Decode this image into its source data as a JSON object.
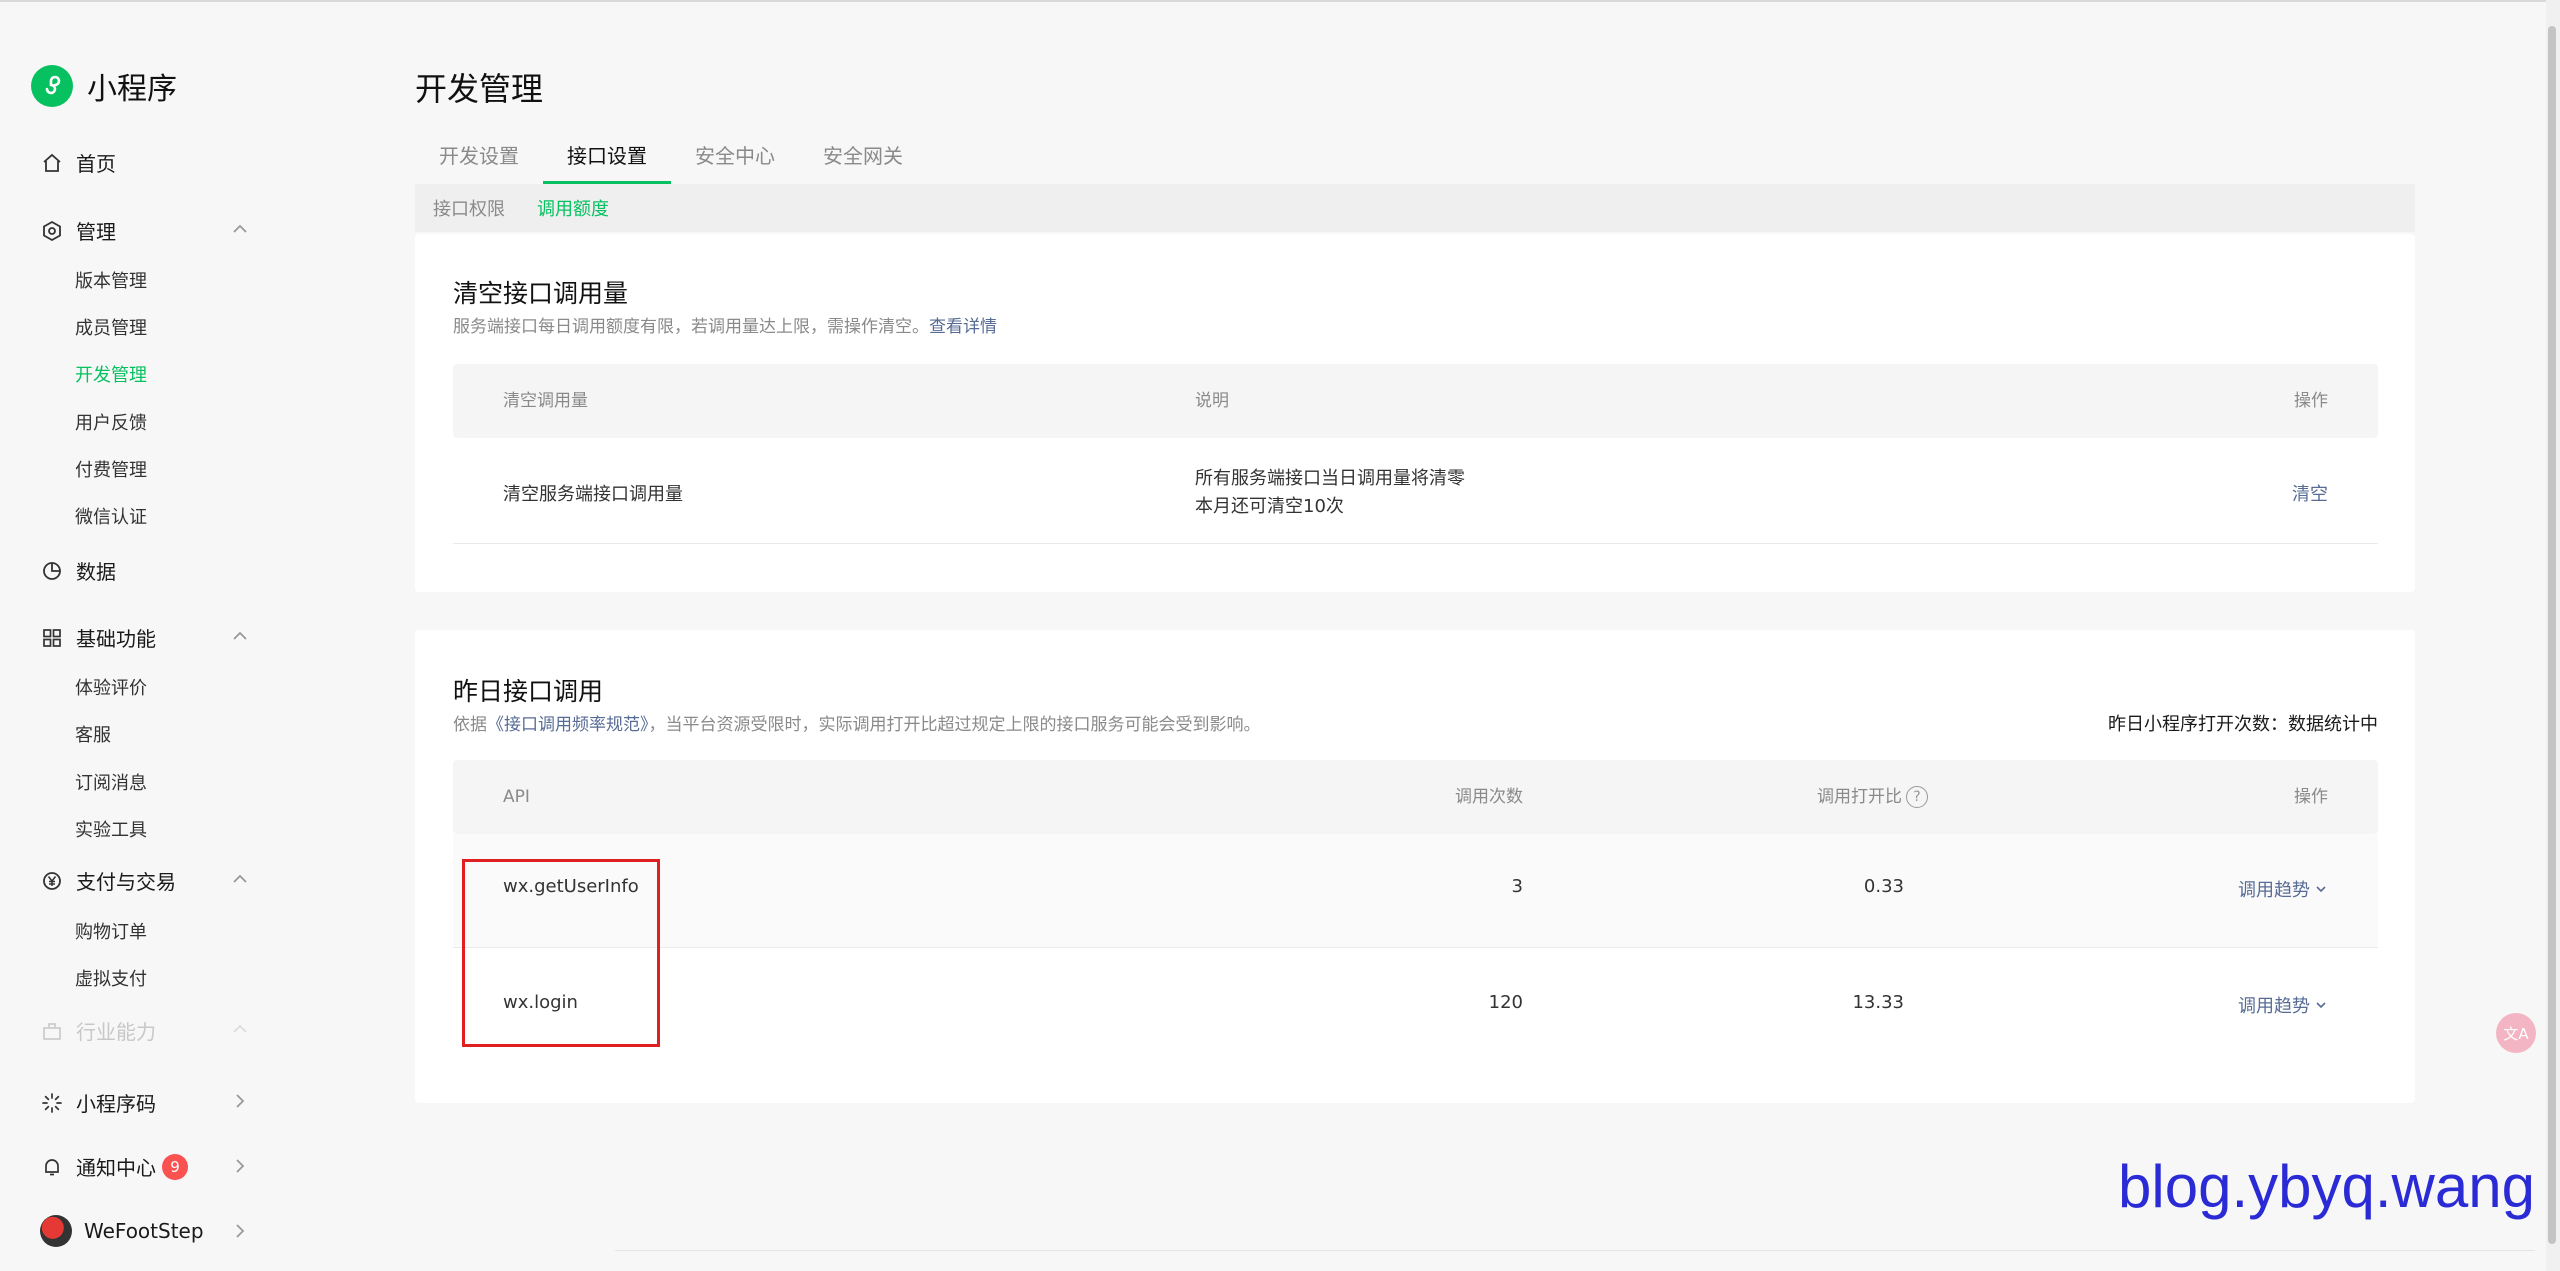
{
  "brand": {
    "name": "小程序"
  },
  "sidebar": {
    "home": "首页",
    "manage": {
      "label": "管理",
      "items": [
        "版本管理",
        "成员管理",
        "开发管理",
        "用户反馈",
        "付费管理",
        "微信认证"
      ]
    },
    "data": "数据",
    "basic": {
      "label": "基础功能",
      "items": [
        "体验评价",
        "客服",
        "订阅消息",
        "实验工具"
      ]
    },
    "pay": {
      "label": "支付与交易",
      "items": [
        "购物订单",
        "虚拟支付"
      ]
    },
    "industry": "行业能力",
    "qrcode": "小程序码",
    "notify": {
      "label": "通知中心",
      "count": "9"
    },
    "account": "WeFootStep"
  },
  "page": {
    "title": "开发管理",
    "tabs": [
      "开发设置",
      "接口设置",
      "安全中心",
      "安全网关"
    ],
    "subtabs": [
      "接口权限",
      "调用额度"
    ]
  },
  "clear_card": {
    "title": "清空接口调用量",
    "desc": "服务端接口每日调用额度有限，若调用量达上限，需操作清空。",
    "desc_link": "查看详情",
    "headers": [
      "清空调用量",
      "说明",
      "操作"
    ],
    "row": {
      "name": "清空服务端接口调用量",
      "note_line1": "所有服务端接口当日调用量将清零",
      "note_line2": "本月还可清空10次",
      "action": "清空"
    }
  },
  "yesterday_card": {
    "title": "昨日接口调用",
    "desc_prefix": "依据",
    "desc_link": "《接口调用频率规范》",
    "desc_suffix": "，当平台资源受限时，实际调用打开比超过规定上限的接口服务可能会受到影响。",
    "stat": "昨日小程序打开次数：数据统计中",
    "headers": [
      "API",
      "调用次数",
      "调用打开比",
      "操作"
    ],
    "rows": [
      {
        "api": "wx.getUserInfo",
        "count": "3",
        "ratio": "0.33",
        "action": "调用趋势"
      },
      {
        "api": "wx.login",
        "count": "120",
        "ratio": "13.33",
        "action": "调用趋势"
      }
    ]
  },
  "watermark": "blog.ybyq.wang",
  "colors": {
    "accent": "#07c160",
    "link": "#576b95",
    "badge": "#fa5151",
    "highlight": "#e02020"
  }
}
